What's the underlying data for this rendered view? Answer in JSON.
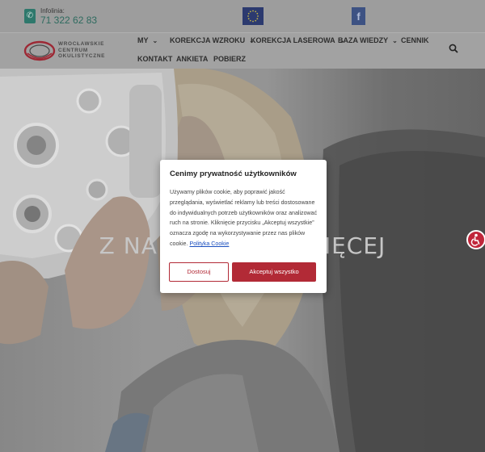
{
  "topbar": {
    "infolinia_label": "Infolinia:",
    "phone_number": "71 322 62 83",
    "icons": [
      "phone-icon",
      "eu-flag-icon",
      "facebook-icon"
    ],
    "facebook_glyph": "f"
  },
  "logo": {
    "line1": "Wrocławskie",
    "line2": "Centrum",
    "line3": "Okulistyczne"
  },
  "nav": {
    "items": [
      {
        "label": "MY",
        "has_dropdown": true
      },
      {
        "label": "KOREKCJA WZROKU",
        "has_dropdown": true
      },
      {
        "label": "KOREKCJA LASEROWA",
        "has_dropdown": true
      },
      {
        "label": "BAZA WIEDZY",
        "has_dropdown": true
      },
      {
        "label": "CENNIK",
        "has_dropdown": false
      },
      {
        "label": "KONTAKT",
        "has_dropdown": false
      },
      {
        "label": "ANKIETA",
        "has_dropdown": false
      },
      {
        "label": "POBIERZ",
        "has_dropdown": false
      }
    ],
    "chevron": "⌄",
    "search_icon": "search-icon"
  },
  "hero": {
    "title_left": "Z NA",
    "title_right": "IĘCEJ"
  },
  "cookie_modal": {
    "title": "Cenimy prywatność użytkowników",
    "body": "Używamy plików cookie, aby poprawić jakość przeglądania, wyświetlać reklamy lub treści dostosowane do indywidualnych potrzeb użytkowników oraz analizować ruch na stronie. Kliknięcie przycisku „Akceptuj wszystkie” oznacza zgodę na wykorzystywanie przez nas plików cookie.",
    "policy_link": "Polityka Cookie",
    "customize_button": "Dostosuj",
    "accept_button": "Akceptuj wszystko"
  },
  "accessibility_button": {
    "icon": "accessibility-icon"
  },
  "colors": {
    "accent_red": "#b22a36",
    "teal": "#2f7d70",
    "link_blue": "#1b4fbf",
    "eu_blue": "#2d3b73",
    "facebook_blue": "#3f5588"
  }
}
